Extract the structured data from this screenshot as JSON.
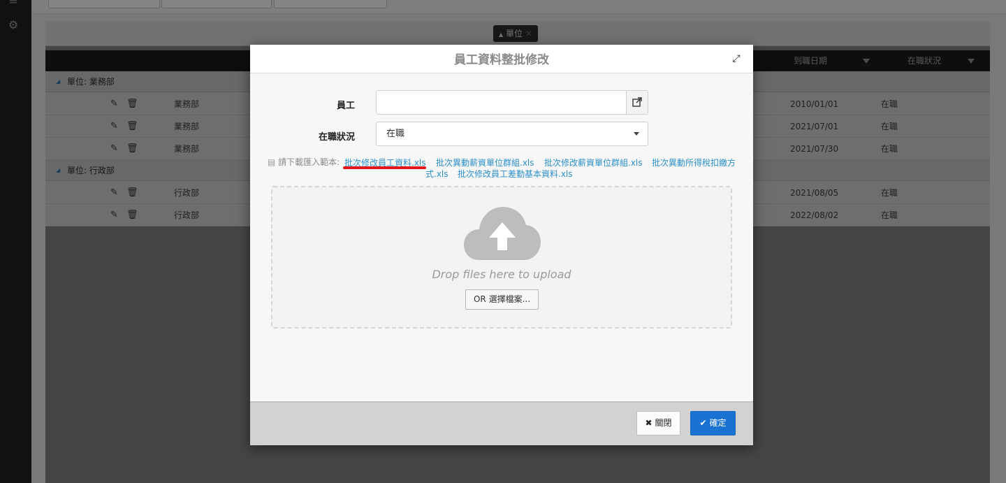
{
  "background": {
    "group_chip": "單位",
    "columns": {
      "hire_date": "到職日期",
      "status": "在職狀況"
    },
    "groups": [
      {
        "title": "單位: 業務部",
        "rows": [
          {
            "dept": "業務部",
            "hire_date": "2010/01/01",
            "status": "在職"
          },
          {
            "dept": "業務部",
            "hire_date": "2021/07/01",
            "status": "在職"
          },
          {
            "dept": "業務部",
            "hire_date": "2021/07/30",
            "status": "在職"
          }
        ]
      },
      {
        "title": "單位: 行政部",
        "rows": [
          {
            "dept": "行政部",
            "hire_date": "2021/08/05",
            "status": "在職"
          },
          {
            "dept": "行政部",
            "hire_date": "2022/08/02",
            "status": "在職"
          }
        ]
      }
    ]
  },
  "modal": {
    "title": "員工資料整批修改",
    "employee_label": "員工",
    "employee_value": "",
    "status_label": "在職狀況",
    "status_value": "在職",
    "template_prefix": "請下載匯入範本:",
    "template_links": [
      "批次修改員工資料.xls",
      "批次異動薪資單位群組.xls",
      "批次修改薪資單位群組.xls",
      "批次異動所得稅扣繳方",
      "式.xls",
      "批次修改員工差勤基本資料.xls"
    ],
    "drop_text": "Drop files here to upload",
    "choose_button": "OR 選擇檔案...",
    "close_button": "關閉",
    "ok_button": "確定"
  },
  "colors": {
    "accent": "#1a73d2",
    "link": "#2b8fc9",
    "highlight": "#e3141a"
  }
}
